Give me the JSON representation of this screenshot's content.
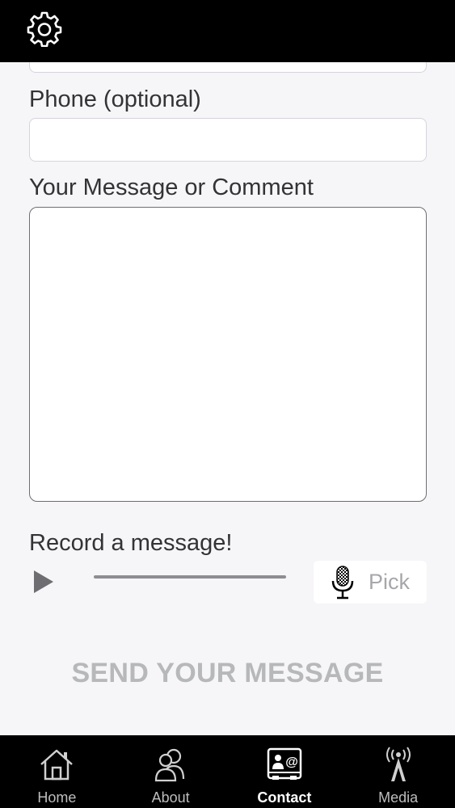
{
  "header": {
    "settings_icon": "gear-icon"
  },
  "form": {
    "phone_label": "Phone (optional)",
    "phone_value": "",
    "message_label": "Your Message or Comment",
    "message_value": "",
    "record_label": "Record a message!",
    "record_progress": 0,
    "pick_label": "Pick",
    "send_label": "SEND YOUR MESSAGE"
  },
  "tabs": [
    {
      "label": "Home",
      "icon": "home-icon",
      "active": false
    },
    {
      "label": "About",
      "icon": "people-icon",
      "active": false
    },
    {
      "label": "Contact",
      "icon": "contact-card-icon",
      "active": true
    },
    {
      "label": "Media",
      "icon": "broadcast-tower-icon",
      "active": false
    }
  ],
  "colors": {
    "bar_background": "#000000",
    "page_background": "#f6f5f7",
    "active_tab_label": "#ffffff",
    "send_button_text": "#b6b8ba"
  }
}
